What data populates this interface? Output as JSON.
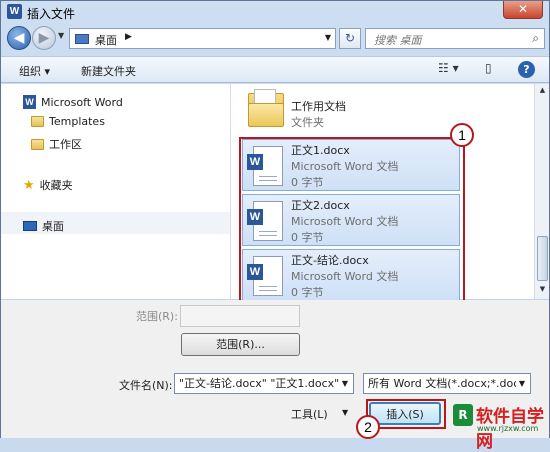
{
  "window": {
    "title": "插入文件",
    "app_icon_letter": "W",
    "close_glyph": "✕"
  },
  "nav": {
    "address": "桌面",
    "search_placeholder": "搜索 桌面"
  },
  "toolbar": {
    "organize": "组织 ▾",
    "new_folder": "新建文件夹",
    "help": "?"
  },
  "sidebar": {
    "items": [
      {
        "label": "Microsoft Word",
        "icon": "word-icon"
      },
      {
        "label": "Templates",
        "icon": "folder-icon"
      },
      {
        "label": "工作区",
        "icon": "folder-icon"
      },
      {
        "label": "收藏夹",
        "icon": "star-icon"
      },
      {
        "label": "桌面",
        "icon": "desktop-icon"
      }
    ]
  },
  "folder": {
    "name": "工作用文档",
    "type": "文件夹"
  },
  "files": [
    {
      "name": "正文1.docx",
      "type": "Microsoft Word 文档",
      "size": "0 字节"
    },
    {
      "name": "正文2.docx",
      "type": "Microsoft Word 文档",
      "size": "0 字节"
    },
    {
      "name": "正文-结论.docx",
      "type": "Microsoft Word 文档",
      "size": "0 字节"
    }
  ],
  "markers": {
    "one": "1",
    "two": "2"
  },
  "bottom": {
    "range_label": "范围(R):",
    "range_button": "范围(R)...",
    "filename_label": "文件名(N):",
    "filename_value": "\"正文-结论.docx\" \"正文1.docx\" \"",
    "filetype_value": "所有 Word 文档(*.docx;*.doc",
    "tools": "工具(L)",
    "insert": "插入(S)"
  },
  "watermark": {
    "text": "软件自学网",
    "url": "www.rjzxw.com"
  }
}
